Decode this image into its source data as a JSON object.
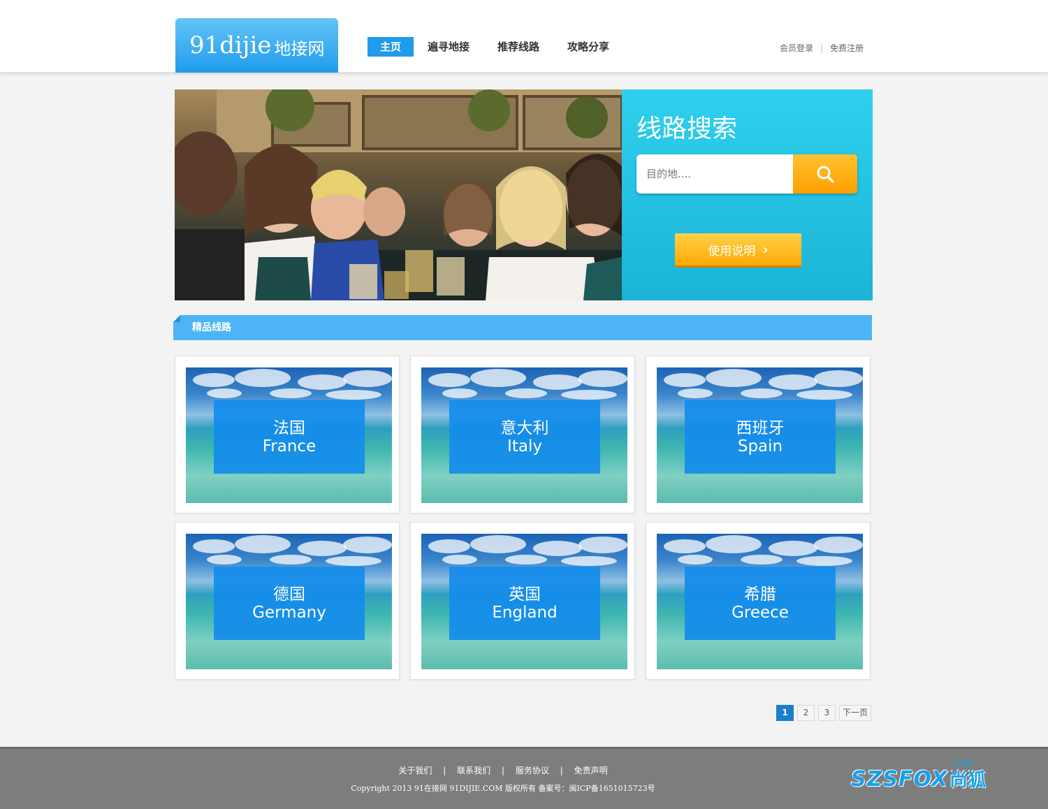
{
  "header": {
    "logo_latin": "91dijie",
    "logo_cn": "地接网",
    "nav": [
      {
        "label": "主页",
        "active": true
      },
      {
        "label": "遍寻地接",
        "active": false
      },
      {
        "label": "推荐线路",
        "active": false
      },
      {
        "label": "攻略分享",
        "active": false
      }
    ],
    "login_label": "会员登录",
    "separator": "|",
    "register_label": "免费注册"
  },
  "banner": {
    "search_title": "线路搜索",
    "search_placeholder": "目的地....",
    "guide_label": "使用说明",
    "guide_arrow": "›"
  },
  "section": {
    "title": "精品线路"
  },
  "routes": [
    {
      "cn": "法国",
      "en": "France"
    },
    {
      "cn": "意大利",
      "en": "Italy"
    },
    {
      "cn": "西班牙",
      "en": "Spain"
    },
    {
      "cn": "德国",
      "en": "Germany"
    },
    {
      "cn": "英国",
      "en": "England"
    },
    {
      "cn": "希腊",
      "en": "Greece"
    }
  ],
  "pagination": {
    "pages": [
      "1",
      "2",
      "3"
    ],
    "current": "1",
    "next_label": "下一页"
  },
  "footer": {
    "links": [
      "关于我们",
      "联系我们",
      "服务协议",
      "免责声明"
    ],
    "separator": "|",
    "copyright": "Copyright 2013 91在接网 91DIJIE.COM 版权所有   备案号：闽ICP备1651015723号",
    "watermark_text": "SZSFOX",
    "watermark_cn": "尚狐",
    "watermark_com": ".COM"
  },
  "colors": {
    "primary_blue": "#1f9cec",
    "section_blue": "#4db5f6",
    "search_cyan": "#2fd0ee",
    "orange": "#ffa800",
    "footer_gray": "#7d7d7d"
  }
}
